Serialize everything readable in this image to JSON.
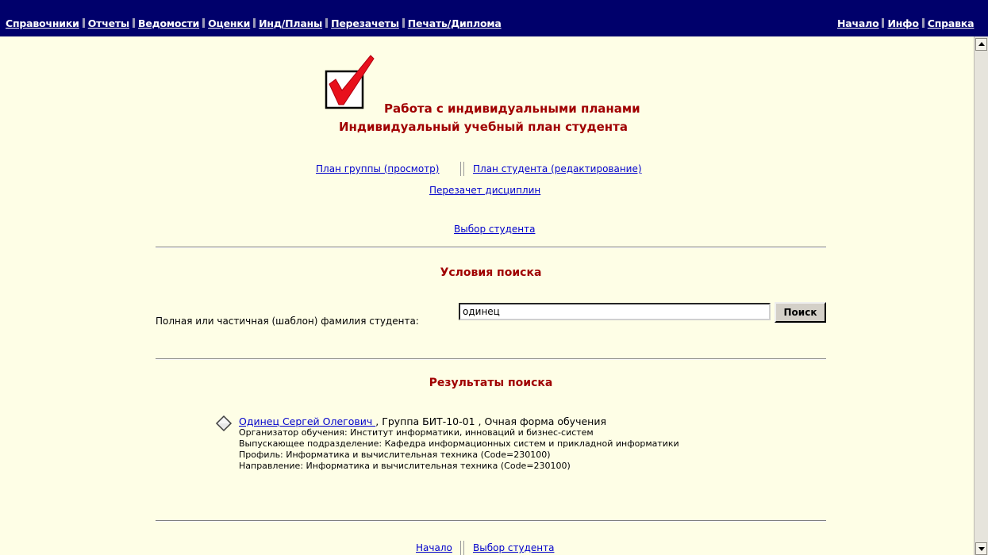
{
  "topnav": {
    "left": [
      "Справочники",
      "Отчеты",
      "Ведомости",
      "Оценки",
      "Инд/Планы",
      "Перезачеты",
      "Печать/Диплома"
    ],
    "right": [
      "Начало",
      "Инфо",
      "Справка"
    ]
  },
  "header": {
    "title": "Работа с индивидуальными планами",
    "subtitle": "Индивидуальный учебный план студента"
  },
  "nav": {
    "group_plan": "План группы (просмотр)",
    "student_plan": "План студента (редактирование)",
    "reoffset": "Перезачет дисциплин",
    "select_student": "Выбор студента "
  },
  "search": {
    "title": "Условия поиска",
    "label": "Полная или частичная (шаблон) фамилия студента:",
    "value": "одинец",
    "button": "Поиск"
  },
  "results": {
    "title": "Результаты поиска",
    "items": [
      {
        "name": "Одинец Сергей Олегович ",
        "summary": ", Группа БИТ-10-01 , Очная форма обучения",
        "organizer": "Организатор обучения: Институт информатики, инноваций и бизнес-систем",
        "department": "Выпускающее подразделение: Кафедра информационных систем и прикладной информатики",
        "profile": "Профиль: Информатика и вычислительная техника (Code=230100)",
        "direction": "Направление: Информатика и вычислительная техника (Code=230100)"
      }
    ]
  },
  "footer": {
    "home": "Начало",
    "select_student": "Выбор студента "
  },
  "colors": {
    "topbar": "#00006b",
    "background": "#fefee6",
    "heading": "#a00000",
    "link": "#0000cc"
  }
}
